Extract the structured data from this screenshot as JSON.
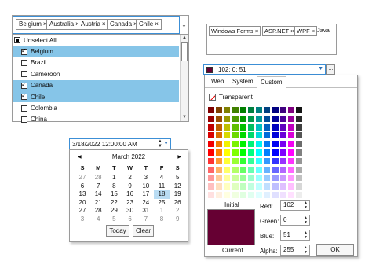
{
  "country_select": {
    "chips": [
      {
        "label": "Belgium"
      },
      {
        "label": "Australia"
      },
      {
        "label": "Austria"
      },
      {
        "label": "Canada"
      },
      {
        "label": "Chile"
      }
    ],
    "chip_remove_glyph": "×",
    "unselect_all_label": "Unselect All",
    "items": [
      {
        "label": "Belgium",
        "checked": true,
        "selected": true
      },
      {
        "label": "Brazil",
        "checked": false,
        "selected": false
      },
      {
        "label": "Cameroon",
        "checked": false,
        "selected": false
      },
      {
        "label": "Canada",
        "checked": true,
        "selected": true
      },
      {
        "label": "Chile",
        "checked": true,
        "selected": true
      },
      {
        "label": "Colombia",
        "checked": false,
        "selected": false
      },
      {
        "label": "China",
        "checked": false,
        "selected": false
      }
    ],
    "selected_color": "#86c5e8"
  },
  "tag_input": {
    "tags": [
      "Windows Forms",
      "ASP.NET",
      "WPF"
    ],
    "typing": "Java"
  },
  "color_picker": {
    "value_text": "102; 0; 51",
    "current_color": "#660033",
    "tabs": [
      "Web",
      "System",
      "Custom"
    ],
    "active_tab": "Custom",
    "transparent_label": "Transparent",
    "initial_label": "Initial",
    "current_label": "Current",
    "channels": [
      {
        "label": "Red:",
        "value": "102"
      },
      {
        "label": "Green:",
        "value": "0"
      },
      {
        "label": "Blue:",
        "value": "51"
      },
      {
        "label": "Alpha:",
        "value": "255"
      }
    ],
    "ok_label": "OK",
    "more_button_label": "..."
  },
  "date_picker": {
    "value_text": "3/18/2022  12:00:00 AM",
    "month_label": "March 2022",
    "weekdays": [
      "S",
      "M",
      "T",
      "W",
      "T",
      "F",
      "S"
    ],
    "weeks": [
      [
        "27",
        "28",
        "1",
        "2",
        "3",
        "4",
        "5"
      ],
      [
        "6",
        "7",
        "8",
        "9",
        "10",
        "11",
        "12"
      ],
      [
        "13",
        "14",
        "15",
        "16",
        "17",
        "18",
        "19"
      ],
      [
        "20",
        "21",
        "22",
        "23",
        "24",
        "25",
        "26"
      ],
      [
        "27",
        "28",
        "29",
        "30",
        "31",
        "1",
        "2"
      ],
      [
        "3",
        "4",
        "5",
        "6",
        "7",
        "8",
        "9"
      ]
    ],
    "selected_day": "18",
    "today_label": "Today",
    "clear_label": "Clear"
  }
}
